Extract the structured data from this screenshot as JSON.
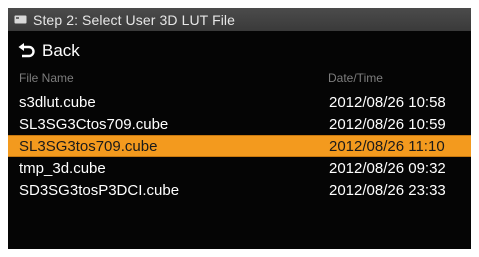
{
  "title": {
    "icon": "card-icon",
    "text": "Step 2: Select User 3D LUT File"
  },
  "back": {
    "icon": "back-arrow-icon",
    "label": "Back"
  },
  "columns": {
    "name": "File Name",
    "datetime": "Date/Time"
  },
  "colors": {
    "selection": "#f39a1e",
    "background": "#050505",
    "titlebar": "#3f3f3f"
  },
  "files": [
    {
      "name": "s3dlut.cube",
      "datetime": "2012/08/26 10:58",
      "selected": false
    },
    {
      "name": "SL3SG3Ctos709.cube",
      "datetime": "2012/08/26 10:59",
      "selected": false
    },
    {
      "name": "SL3SG3tos709.cube",
      "datetime": "2012/08/26 11:10",
      "selected": true
    },
    {
      "name": "tmp_3d.cube",
      "datetime": "2012/08/26 09:32",
      "selected": false
    },
    {
      "name": "SD3SG3tosP3DCI.cube",
      "datetime": "2012/08/26 23:33",
      "selected": false
    }
  ]
}
